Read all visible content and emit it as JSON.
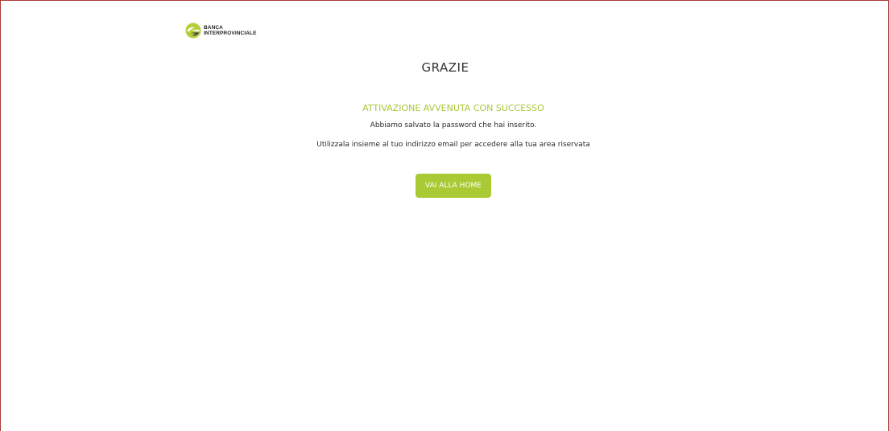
{
  "brand": {
    "logo_icon": "banca-interprovinciale-logo-icon",
    "line1": "BANCA",
    "line2": "INTERPROVINCIALE"
  },
  "page": {
    "title": "GRAZIE",
    "success_heading": "ATTIVAZIONE AVVENUTA CON SUCCESSO",
    "message_line1": "Abbiamo salvato la password che hai inserito.",
    "message_line2": "Utilizzala insieme al tuo indirizzo email per accedere alla tua area riservata"
  },
  "actions": {
    "home_button_label": "VAI ALLA HOME"
  },
  "colors": {
    "accent": "#a9c935",
    "heading_text": "#333333",
    "frame_border": "#a83a3a"
  }
}
